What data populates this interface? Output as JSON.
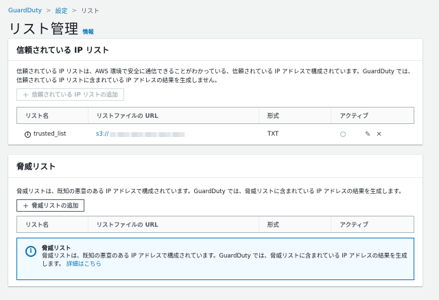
{
  "breadcrumb": {
    "root": "GuardDuty",
    "level1": "設定",
    "current": "リスト"
  },
  "page": {
    "title": "リスト管理",
    "info": "情報"
  },
  "trusted": {
    "header": "信頼されている IP リスト",
    "description": "信頼されている IP リストは、AWS 環境で安全に通信できることがわかっている、信頼されている IP アドレスで構成されています。GuardDuty では、信頼されている IP リストに含まれている IP アドレスの結果を生成しません。",
    "add_button": "信頼されている IP リストの追加",
    "columns": [
      "リスト名",
      "リストファイルの URL",
      "形式",
      "アクティブ"
    ],
    "row": {
      "name": "trusted_list",
      "url_prefix": "s3://",
      "format": "TXT"
    }
  },
  "threat": {
    "header": "脅威リスト",
    "description": "脅威リストは、既知の悪意のある IP アドレスで構成されています。GuardDuty では、脅威リストに含まれている IP アドレスの結果を生成します。",
    "add_button": "脅威リストの追加",
    "columns": [
      "リスト名",
      "リストファイルの URL",
      "形式",
      "アクティブ"
    ],
    "alert": {
      "title": "脅威リスト",
      "body": "脅威リストは、既知の悪意のある IP アドレスで構成されています。GuardDuty では、脅威リストに含まれている IP アドレスの結果を生成します。",
      "link": "詳細はこちら"
    }
  }
}
